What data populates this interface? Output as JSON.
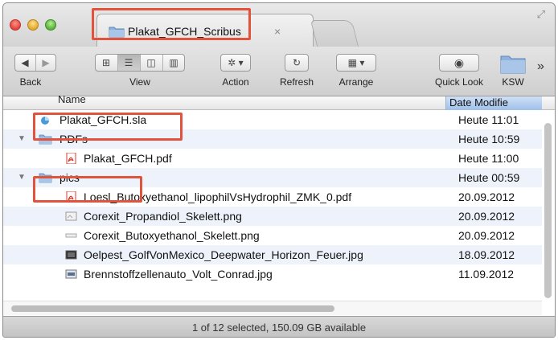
{
  "tab": {
    "title": "Plakat_GFCH_Scribus",
    "close_glyph": "×"
  },
  "toolbar": {
    "back_label": "Back",
    "view_label": "View",
    "action_label": "Action",
    "refresh_label": "Refresh",
    "arrange_label": "Arrange",
    "quicklook_label": "Quick Look",
    "ksw_label": "KSW",
    "overflow_glyph": "»"
  },
  "columns": {
    "name": "Name",
    "date": "Date Modifie"
  },
  "rows": [
    {
      "name": "Plakat_GFCH.sla",
      "date": "Heute 11:01",
      "icon": "scribus-doc-icon",
      "indent": 0,
      "disclosure": ""
    },
    {
      "name": "PDFs",
      "date": "Heute 10:59",
      "icon": "folder-icon",
      "indent": 0,
      "disclosure": "▼"
    },
    {
      "name": "Plakat_GFCH.pdf",
      "date": "Heute 11:00",
      "icon": "pdf-icon",
      "indent": 1,
      "disclosure": ""
    },
    {
      "name": "pics",
      "date": "Heute 00:59",
      "icon": "folder-icon",
      "indent": 0,
      "disclosure": "▼"
    },
    {
      "name": "Loesl_Butoxyethanol_lipophilVsHydrophil_ZMK_0.pdf",
      "date": "20.09.2012",
      "icon": "pdf-icon",
      "indent": 1,
      "disclosure": ""
    },
    {
      "name": "Corexit_Propandiol_Skelett.png",
      "date": "20.09.2012",
      "icon": "image-icon",
      "indent": 1,
      "disclosure": ""
    },
    {
      "name": "Corexit_Butoxyethanol_Skelett.png",
      "date": "20.09.2012",
      "icon": "image-icon",
      "indent": 1,
      "disclosure": ""
    },
    {
      "name": "Oelpest_GolfVonMexico_Deepwater_Horizon_Feuer.jpg",
      "date": "18.09.2012",
      "icon": "photo-icon",
      "indent": 1,
      "disclosure": ""
    },
    {
      "name": "Brennstoffzellenauto_Volt_Conrad.jpg",
      "date": "11.09.2012",
      "icon": "photo-icon",
      "indent": 1,
      "disclosure": ""
    }
  ],
  "status": {
    "text": "1 of 12 selected, 150.09 GB available"
  },
  "colors": {
    "highlight": "#e2533e",
    "folder": "#8fb3dc",
    "pdf": "#d43c2c",
    "selection_header": "#9fc0ea"
  }
}
